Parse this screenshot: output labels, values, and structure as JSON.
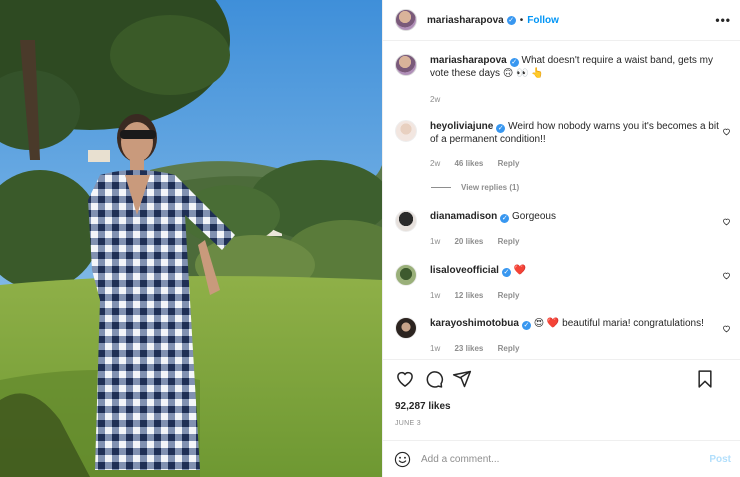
{
  "header": {
    "username": "mariasharapova",
    "separator": "•",
    "follow_label": "Follow",
    "more_label": "•••"
  },
  "caption": {
    "username": "mariasharapova",
    "text": "What doesn't require a waist band, gets my vote these days 🙃 👀 👆",
    "time": "2w"
  },
  "comments": [
    {
      "username": "heyoliviajune",
      "verified": true,
      "text": "Weird how nobody warns you it's becomes a bit of a permanent condition!!",
      "time": "2w",
      "likes": "46 likes",
      "reply": "Reply"
    },
    {
      "username": "dianamadison",
      "verified": true,
      "text": "Gorgeous",
      "time": "1w",
      "likes": "20 likes",
      "reply": "Reply"
    },
    {
      "username": "lisaloveofficial",
      "verified": true,
      "text": "❤️",
      "time": "1w",
      "likes": "12 likes",
      "reply": "Reply"
    },
    {
      "username": "karayoshimotobua",
      "verified": true,
      "text": "😍 ❤️ beautiful maria! congratulations!",
      "time": "1w",
      "likes": "23 likes",
      "reply": "Reply"
    }
  ],
  "view_replies": "View replies (1)",
  "likes_total": "92,287 likes",
  "date": "JUNE 3",
  "add_comment": {
    "placeholder": "Add a comment...",
    "post_label": "Post"
  },
  "icons": [
    "heart-icon",
    "comment-icon",
    "share-icon",
    "bookmark-icon",
    "emoji-icon",
    "verified-badge"
  ],
  "colors": {
    "link": "#0095f6",
    "verified": "#3897f0",
    "post_disabled": "#b2dffc",
    "muted": "#8e8e8e"
  }
}
